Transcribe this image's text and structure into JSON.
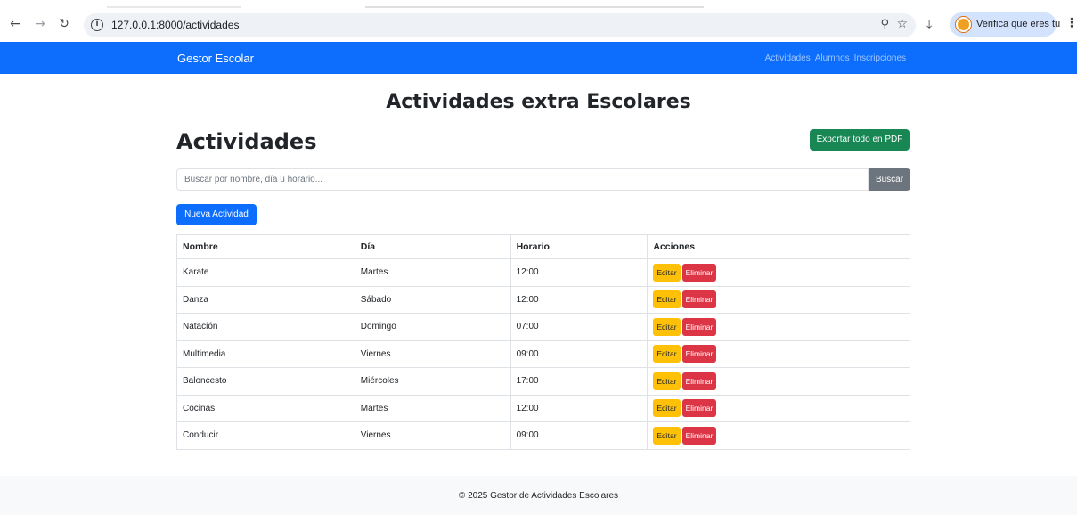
{
  "browser": {
    "url": "127.0.0.1:8000/actividades",
    "profile_label": "Verifica que eres tú"
  },
  "navbar": {
    "brand": "Gestor Escolar",
    "links": [
      "Actividades",
      "Alumnos",
      "Inscripciones"
    ]
  },
  "main": {
    "heading": "Actividades extra Escolares",
    "section_title": "Actividades",
    "export_button": "Exportar todo en PDF",
    "search": {
      "placeholder": "Buscar por nombre, día u horario...",
      "value": "",
      "button": "Buscar"
    },
    "new_button": "Nueva Actividad",
    "table": {
      "headers": [
        "Nombre",
        "Día",
        "Horario",
        "Acciones"
      ],
      "rows": [
        {
          "nombre": "Karate",
          "dia": "Martes",
          "horario": "12:00"
        },
        {
          "nombre": "Danza",
          "dia": "Sábado",
          "horario": "12:00"
        },
        {
          "nombre": "Natación",
          "dia": "Domingo",
          "horario": "07:00"
        },
        {
          "nombre": "Multimedia",
          "dia": "Viernes",
          "horario": "09:00"
        },
        {
          "nombre": "Baloncesto",
          "dia": "Miércoles",
          "horario": "17:00"
        },
        {
          "nombre": "Cocinas",
          "dia": "Martes",
          "horario": "12:00"
        },
        {
          "nombre": "Conducir",
          "dia": "Viernes",
          "horario": "09:00"
        }
      ],
      "edit_label": "Editar",
      "delete_label": "Eliminar"
    }
  },
  "footer": {
    "text": "© 2025 Gestor de Actividades Escolares"
  },
  "colors": {
    "primary": "#0d6efd",
    "success": "#198754",
    "secondary": "#6c757d",
    "warning": "#ffc107",
    "danger": "#dc3545"
  },
  "icons": [
    "back-arrow-icon",
    "forward-arrow-icon",
    "reload-icon",
    "info-icon",
    "zoom-icon",
    "star-icon",
    "download-icon",
    "avatar-icon",
    "kebab-menu-icon"
  ]
}
